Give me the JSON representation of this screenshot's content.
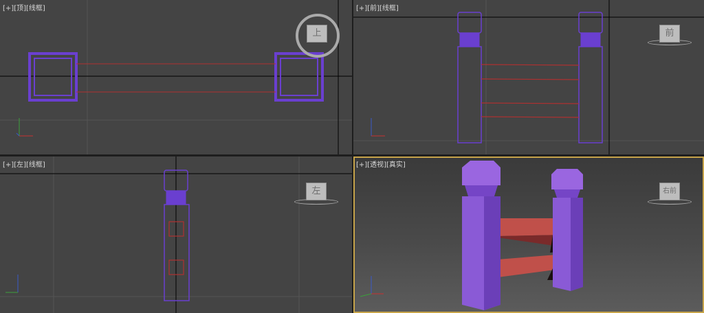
{
  "viewports": {
    "top": {
      "plus": "[+]",
      "view": "[顶]",
      "shading": "[线框]",
      "cube_face": "上"
    },
    "front": {
      "plus": "[+]",
      "view": "[前]",
      "shading": "[线框]",
      "cube_face": "前"
    },
    "left": {
      "plus": "[+]",
      "view": "[左]",
      "shading": "[线框]",
      "cube_face": "左"
    },
    "perspective": {
      "plus": "[+]",
      "view": "[透视]",
      "shading": "[真实]",
      "cube_face": "右前"
    }
  },
  "colors": {
    "background": "#444444",
    "grid": "#5a5a5a",
    "post_wire": "#6a3fd0",
    "rail_wire": "#b03030",
    "post_shaded": "#8a5ad6",
    "rail_shaded": "#c0504a",
    "active_border": "#c7a44a"
  }
}
